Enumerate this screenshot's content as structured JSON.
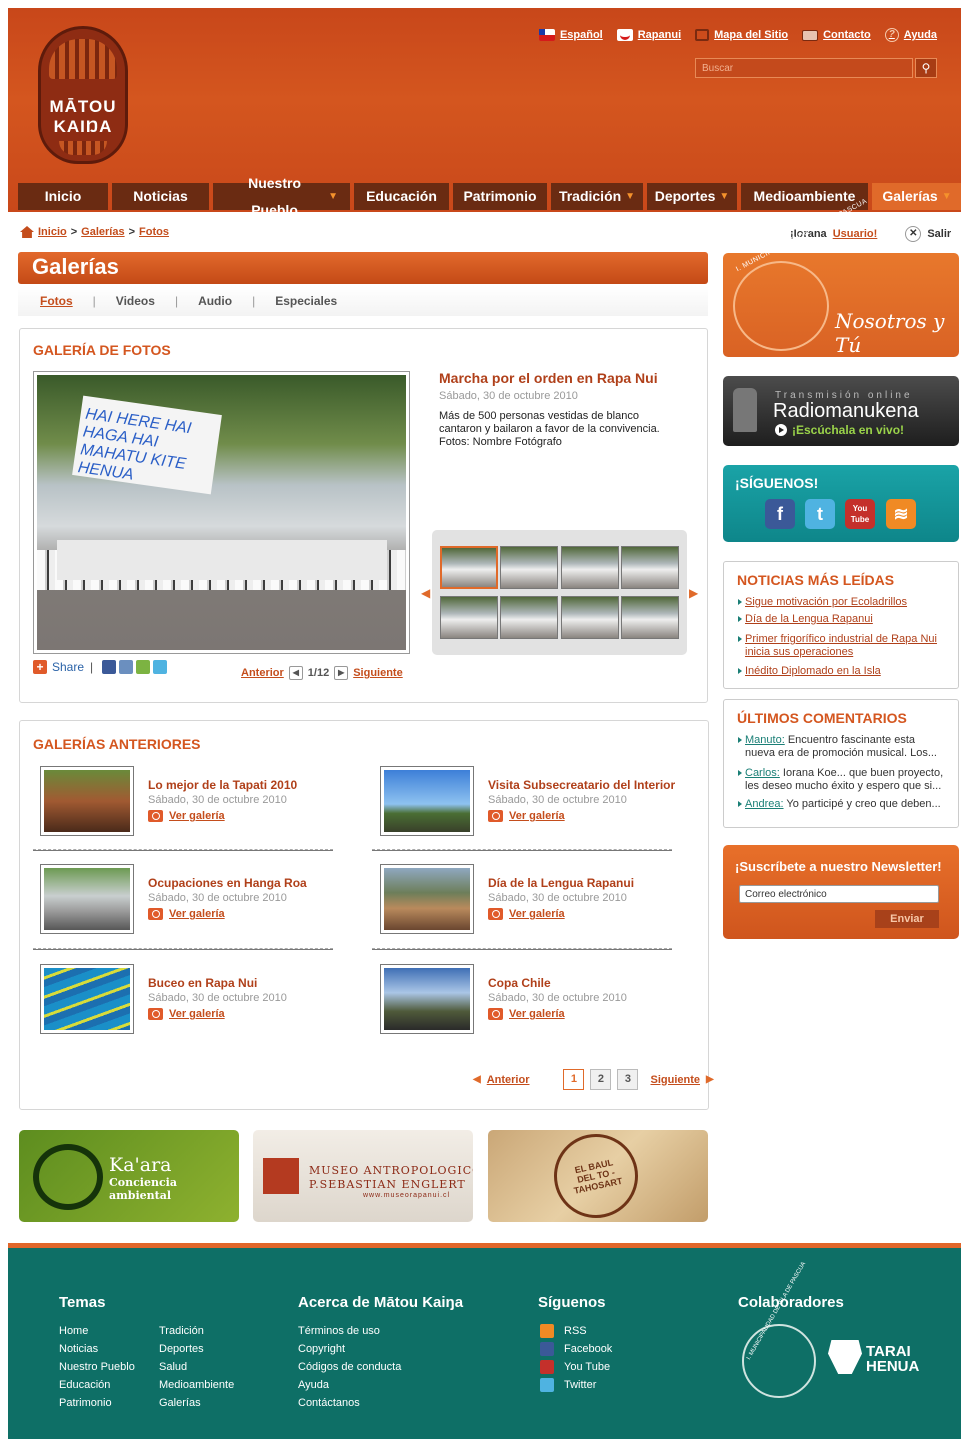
{
  "header": {
    "logo_line1": "MĀTOU",
    "logo_line2": "KAIŊA",
    "links": [
      "Español",
      "Rapanui",
      "Mapa del Sitio",
      "Contacto",
      "Ayuda"
    ],
    "search_placeholder": "Buscar"
  },
  "nav": [
    {
      "label": "Inicio"
    },
    {
      "label": "Noticias"
    },
    {
      "label": "Nuestro Pueblo",
      "dropdown": "▼"
    },
    {
      "label": "Educación"
    },
    {
      "label": "Patrimonio"
    },
    {
      "label": "Tradición",
      "dropdown": "▼"
    },
    {
      "label": "Deportes",
      "dropdown": "▼"
    },
    {
      "label": "Medioambiente"
    },
    {
      "label": "Galerías",
      "dropdown": "▼"
    }
  ],
  "breadcrumb": {
    "home": "Inicio",
    "sep": ">",
    "b1": "Galerías",
    "b2": "Fotos"
  },
  "user": {
    "greeting": "¡Iorana",
    "name": "Usuario!",
    "logout": "Salir"
  },
  "page_title": "Galerías",
  "subtabs": [
    "Fotos",
    "Videos",
    "Audio",
    "Especiales"
  ],
  "gallery": {
    "section_title": "GALERÍA DE FOTOS",
    "title": "Marcha por el orden en Rapa Nui",
    "date": "Sábado, 30 de octubre 2010",
    "description": "Más de 500 personas vestidas de blanco cantaron y bailaron a favor de la convivencia.",
    "credit": "Fotos: Nombre Fotógrafo",
    "banner_text": "HAI HERE HAI HAGA HAI MAHATU KITE HENUA",
    "share": "Share",
    "prev": "Anterior",
    "counter": "1/12",
    "next": "Siguiente"
  },
  "previous": {
    "section_title": "GALERÍAS ANTERIORES",
    "view_label": "Ver galería",
    "items": [
      {
        "title": "Lo mejor de la Tapati 2010",
        "date": "Sábado, 30 de octubre 2010"
      },
      {
        "title": "Visita Subsecreatario del Interior",
        "date": "Sábado, 30 de octubre 2010"
      },
      {
        "title": "Ocupaciones en Hanga Roa",
        "date": "Sábado, 30 de octubre 2010"
      },
      {
        "title": "Día de la Lengua Rapanui",
        "date": "Sábado, 30 de octubre 2010"
      },
      {
        "title": "Buceo en Rapa Nui",
        "date": "Sábado, 30 de octubre 2010"
      },
      {
        "title": "Copa Chile",
        "date": "Sábado, 30 de octubre 2010"
      }
    ],
    "pager": {
      "prev": "Anterior",
      "pages": [
        "1",
        "2",
        "3"
      ],
      "next": "Siguiente"
    }
  },
  "sponsors": {
    "kaara_title": "Ka'ara",
    "kaara_sub": "Conciencia ambiental",
    "museo_line1": "MUSEO ANTROPOLOGICO",
    "museo_line2": "P.SEBASTIAN ENGLERT",
    "museo_url": "www.museorapanui.cl",
    "baul_text": "EL BAUL DEL TO - TAHOSART"
  },
  "sidebar": {
    "muni_ring": "I. MUNICIPALIDAD DE ISLA DE PASCUA",
    "nosotros": "Nosotros y Tú",
    "radio_top": "Transmisión online",
    "radio_name": "Radiomanukena",
    "radio_cta": "¡Escúchala en vivo!",
    "follow": "¡SÍGUENOS!",
    "follow_youtube": "You Tube",
    "most_read_title": "NOTICIAS MÁS LEÍDAS",
    "most_read": [
      "Sigue motivación por Ecoladrillos",
      "Día de la Lengua Rapanui",
      "Primer frigorífico industrial de Rapa Nui inicia sus operaciones",
      "Inédito Diplomado en la Isla"
    ],
    "comments_title": "ÚLTIMOS COMENTARIOS",
    "comments": [
      {
        "user": "Manuto:",
        "text": "Encuentro fascinante esta nueva era de promoción musical. Los..."
      },
      {
        "user": "Carlos:",
        "text": "Iorana Koe... que buen proyecto, les deseo mucho éxito y espero que si..."
      },
      {
        "user": "Andrea:",
        "text": "Yo participé y creo que deben..."
      }
    ],
    "newsletter_title": "¡Suscríbete a nuestro Newsletter!",
    "newsletter_placeholder": "Correo electrónico",
    "newsletter_button": "Enviar"
  },
  "footer": {
    "temas_title": "Temas",
    "temas_col1": [
      "Home",
      "Noticias",
      "Nuestro Pueblo",
      "Educación",
      "Patrimonio"
    ],
    "temas_col2": [
      "Tradición",
      "Deportes",
      "Salud",
      "Medioambiente",
      "Galerías"
    ],
    "acerca_title": "Acerca de Mātou Kaiŋa",
    "acerca": [
      "Términos de uso",
      "Copyright",
      "Códigos de conducta",
      "Ayuda",
      "Contáctanos"
    ],
    "siguenos_title": "Síguenos",
    "siguenos": [
      "RSS",
      "Facebook",
      "You Tube",
      "Twitter"
    ],
    "colab_title": "Colaboradores",
    "muni_ring": "I. MUNICIPALIDAD DE ISLA DE PASCUA",
    "tarai_line1": "TARAI",
    "tarai_line2": "HENUA"
  }
}
